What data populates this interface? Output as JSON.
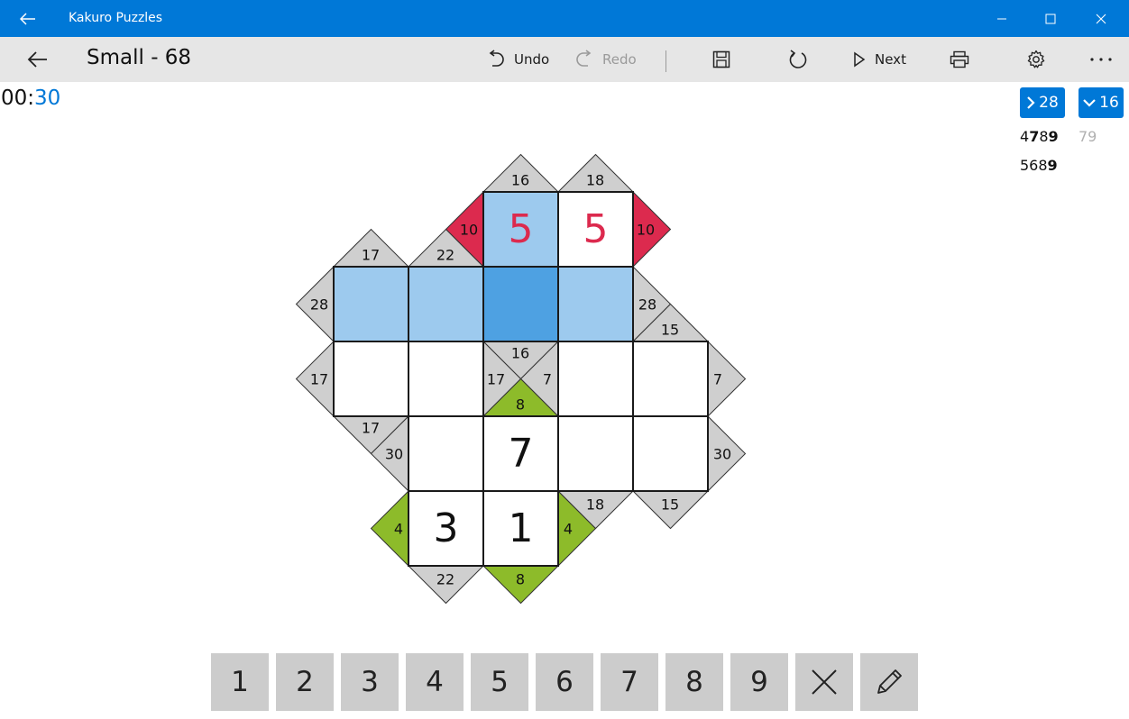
{
  "titlebar": {
    "app_title": "Kakuro Puzzles"
  },
  "toolbar": {
    "puzzle_title": "Small - 68",
    "undo_label": "Undo",
    "redo_label": "Redo",
    "next_label": "Next"
  },
  "timer": {
    "minutes": "00",
    "sep": ":",
    "seconds": "30"
  },
  "hints": {
    "across_value": "28",
    "down_value": "16",
    "combo_row1_active": "4789",
    "combo_row1_dim": "79",
    "combo_row2": "5689"
  },
  "clues": {
    "c16_top": "16",
    "c18_top": "18",
    "c10_left": "10",
    "c10_right": "10",
    "c17_tl": "17",
    "c22_t": "22",
    "c28_left": "28",
    "c28_right": "28",
    "c15_right": "15",
    "c17_left": "17",
    "c16_mid": "16",
    "c17_mid": "17",
    "c7_mid": "7",
    "c8_mid": "8",
    "c7_right": "7",
    "c17_l2": "17",
    "c30_l": "30",
    "c30_r": "30",
    "c4_l": "4",
    "c4_r": "4",
    "c18_r": "18",
    "c15_r2": "15",
    "c22_b": "22",
    "c8_b": "8"
  },
  "cells": {
    "r0c2": "5",
    "r0c3": "5",
    "r3c2": "7",
    "r4c1": "3",
    "r4c2": "1"
  },
  "colors": {
    "accent": "#0078d7",
    "highlight": "#9dcaee",
    "selected": "#4ea1e2",
    "clue_gray": "#cfcfcf",
    "error_red": "#dc2a4e",
    "ok_green": "#8dbb2a"
  },
  "keypad": {
    "keys": [
      "1",
      "2",
      "3",
      "4",
      "5",
      "6",
      "7",
      "8",
      "9"
    ]
  }
}
